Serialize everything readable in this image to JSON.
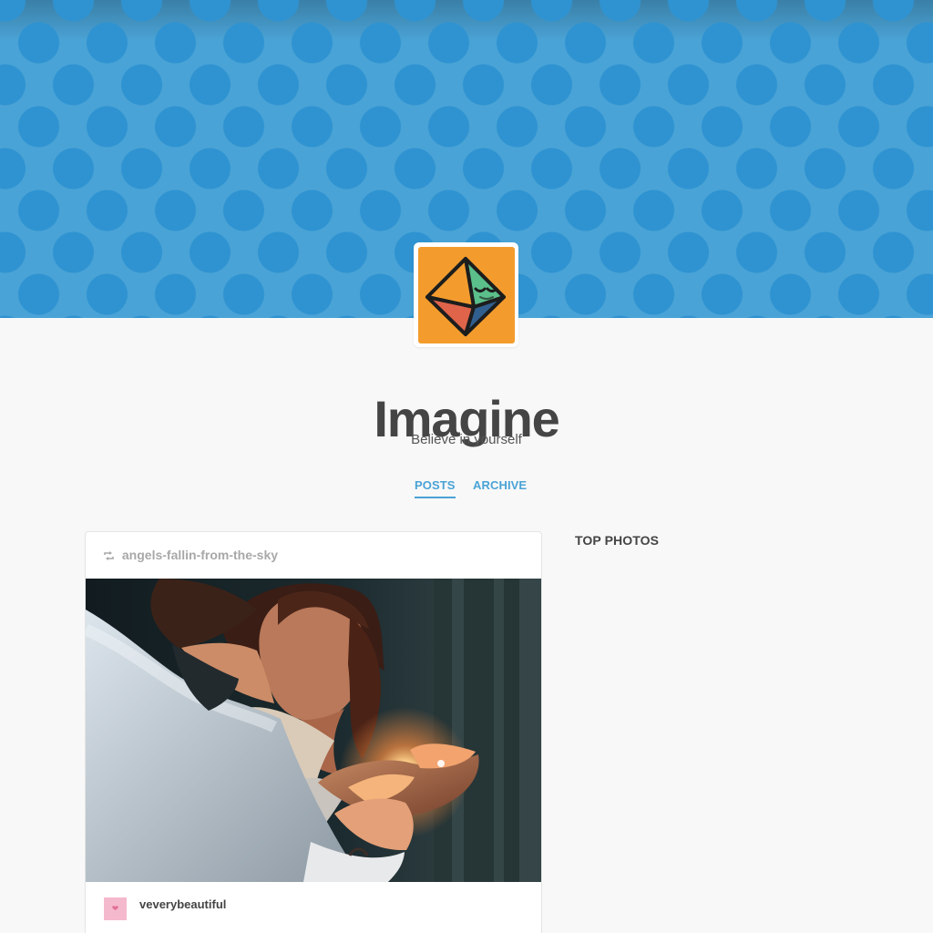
{
  "blog": {
    "title": "Imagine",
    "description": "Believe in yourself"
  },
  "nav": {
    "posts": "POSTS",
    "archive": "ARCHIVE"
  },
  "post": {
    "reblogged_from": "angels-fallin-from-the-sky",
    "author": "veverybeautiful"
  },
  "sidebar": {
    "top_photos": "TOP PHOTOS"
  },
  "icons": {
    "avatar": "sleeping-octahedron-icon",
    "reblog": "reblog-icon",
    "author_avatar": "heart-icon"
  },
  "colors": {
    "banner": "#4aa3d6",
    "polka_dots": "#2f93d1",
    "avatar_background": "#f39c2d",
    "nav_link": "#4aa3d6",
    "title_text": "#454545"
  }
}
